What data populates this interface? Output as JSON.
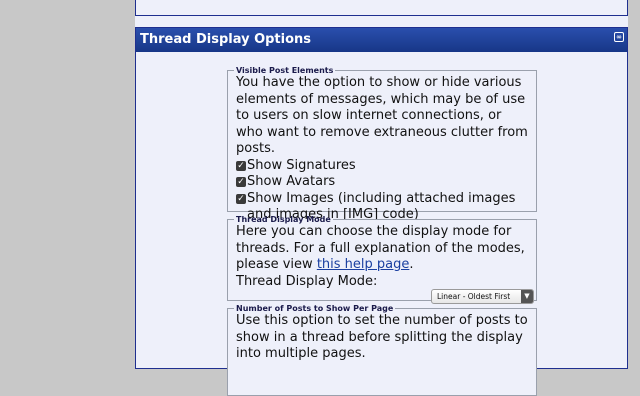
{
  "section": {
    "title": "Thread Display Options",
    "collapse_icon": "collapse-icon"
  },
  "visible_post_elements": {
    "legend": "Visible Post Elements",
    "description": "You have the option to show or hide various elements of messages, which may be of use to users on slow internet connections, or who want to remove extraneous clutter from posts.",
    "options": [
      {
        "label": "Show Signatures",
        "checked": true
      },
      {
        "label": "Show Avatars",
        "checked": true
      },
      {
        "label": "Show Images (including attached images and images in [IMG] code)",
        "checked": true
      }
    ]
  },
  "thread_display_mode": {
    "legend": "Thread Display Mode",
    "description_before_link": "Here you can choose the display mode for threads. For a full explanation of the modes, please view ",
    "link_text": "this help page",
    "description_after_link": ".",
    "field_label": "Thread Display Mode:",
    "selected_value": "Linear - Oldest First"
  },
  "posts_per_page": {
    "legend": "Number of Posts to Show Per Page",
    "description": "Use this option to set the number of posts to show in a thread before splitting the display into multiple pages."
  }
}
